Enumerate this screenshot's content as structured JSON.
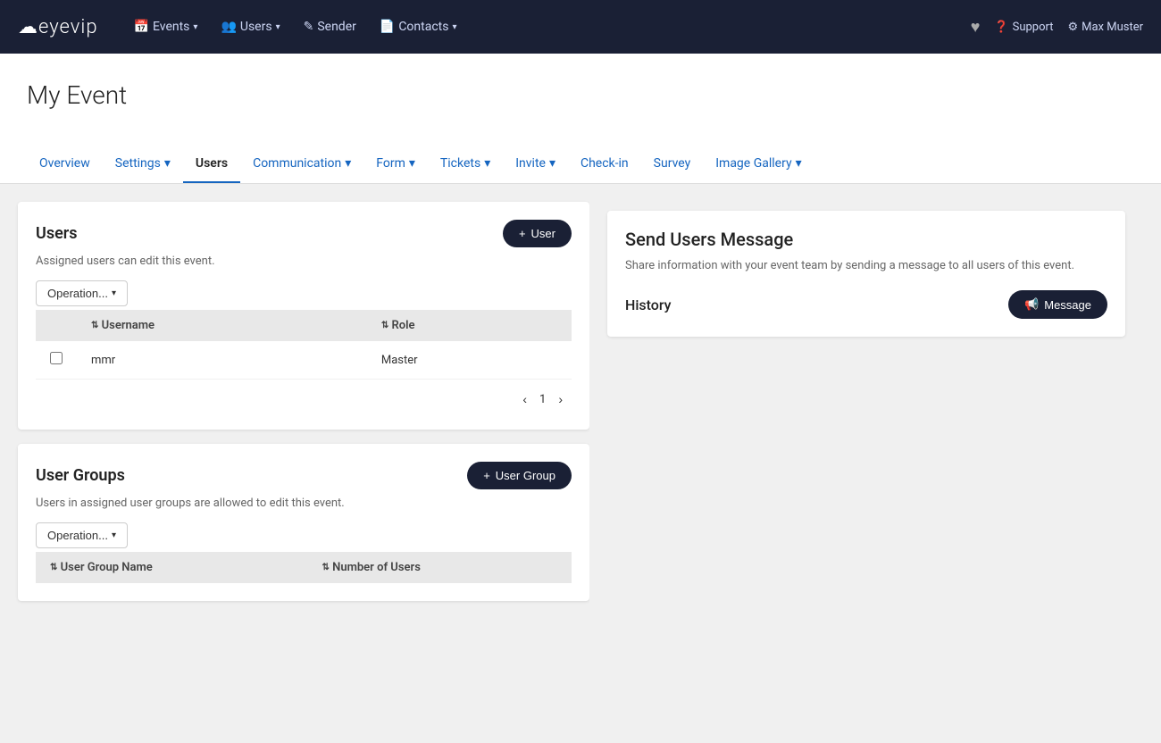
{
  "logo": {
    "text": "eyevip"
  },
  "topnav": {
    "items": [
      {
        "icon": "📅",
        "label": "Events",
        "hasDropdown": true
      },
      {
        "icon": "👥",
        "label": "Users",
        "hasDropdown": true
      },
      {
        "icon": "✏️",
        "label": "Sender",
        "hasDropdown": false
      },
      {
        "icon": "📇",
        "label": "Contacts",
        "hasDropdown": true
      }
    ],
    "right": {
      "heart_icon": "♥",
      "support_label": "Support",
      "user_label": "Max Muster"
    }
  },
  "page": {
    "title": "My Event"
  },
  "tabs": [
    {
      "label": "Overview",
      "active": false,
      "hasDropdown": false
    },
    {
      "label": "Settings",
      "active": false,
      "hasDropdown": true
    },
    {
      "label": "Users",
      "active": true,
      "hasDropdown": false
    },
    {
      "label": "Communication",
      "active": false,
      "hasDropdown": true
    },
    {
      "label": "Form",
      "active": false,
      "hasDropdown": true
    },
    {
      "label": "Tickets",
      "active": false,
      "hasDropdown": true
    },
    {
      "label": "Invite",
      "active": false,
      "hasDropdown": true
    },
    {
      "label": "Check-in",
      "active": false,
      "hasDropdown": false
    },
    {
      "label": "Survey",
      "active": false,
      "hasDropdown": false
    },
    {
      "label": "Image Gallery",
      "active": false,
      "hasDropdown": true
    }
  ],
  "users_card": {
    "title": "Users",
    "subtitle": "Assigned users can edit this event.",
    "add_button": "User",
    "operation_label": "Operation...",
    "table": {
      "columns": [
        {
          "label": "Username",
          "sortable": true
        },
        {
          "label": "Role",
          "sortable": true
        }
      ],
      "rows": [
        {
          "username": "mmr",
          "role": "Master"
        }
      ]
    },
    "pagination": {
      "prev": "‹",
      "page": "1",
      "next": "›"
    }
  },
  "user_groups_card": {
    "title": "User Groups",
    "subtitle": "Users in assigned user groups are allowed to edit this event.",
    "add_button": "User Group",
    "operation_label": "Operation...",
    "table": {
      "columns": [
        {
          "label": "User Group Name",
          "sortable": true
        },
        {
          "label": "Number of Users",
          "sortable": true
        }
      ],
      "rows": []
    }
  },
  "send_message": {
    "title": "Send Users Message",
    "description": "Share information with your event team by sending a message to all users of this event.",
    "history_label": "History",
    "message_button": "Message"
  }
}
